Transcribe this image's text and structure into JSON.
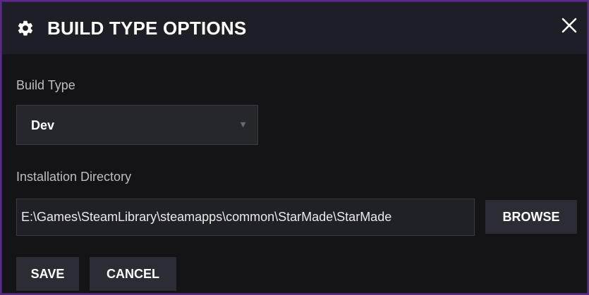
{
  "dialog": {
    "title": "BUILD TYPE OPTIONS",
    "icon": "gear-icon",
    "close_icon": "close-icon"
  },
  "build_type": {
    "label": "Build Type",
    "selected": "Dev",
    "arrow": "▼"
  },
  "installation_directory": {
    "label": "Installation Directory",
    "value": "E:\\Games\\SteamLibrary\\steamapps\\common\\StarMade\\StarMade",
    "browse_label": "BROWSE"
  },
  "actions": {
    "save_label": "SAVE",
    "cancel_label": "CANCEL"
  },
  "colors": {
    "background": "#141417",
    "titlebar": "#1e1f26",
    "button": "#2c2d34",
    "text": "#ffffff",
    "label": "#bdbdc2",
    "frame": "#5a2a86"
  }
}
